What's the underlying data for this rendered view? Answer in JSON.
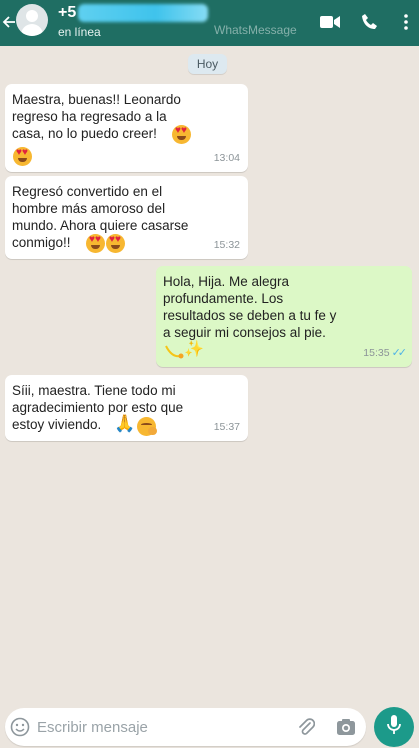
{
  "header": {
    "contact_name_prefix": "+5",
    "status": "en línea",
    "watermark": "WhatsMessage",
    "icons": [
      "back-arrow-icon",
      "avatar",
      "video-call-icon",
      "phone-call-icon"
    ]
  },
  "chat": {
    "date_label": "Hoy",
    "messages": [
      {
        "direction": "incoming",
        "text": "Maestra, buenas!! Leonardo\nregreso ha regresado a la\ncasa, no lo puedo creer!",
        "emoji": [
          "heart-eyes-emoji",
          "heart-eyes-emoji"
        ],
        "time": "13:04"
      },
      {
        "direction": "incoming",
        "text": "Regresó convertido en el\nhombre más amoroso del\nmundo. Ahora quiere casarse\nconmigo!!",
        "emoji": [
          "heart-eyes-emoji",
          "heart-eyes-emoji"
        ],
        "time": "15:32"
      },
      {
        "direction": "outgoing",
        "text": "Hola, Hija. Me alegra\nprofundamente. Los\nresultados se deben a tu fe y\na seguir mi consejos al pie.",
        "emoji": [
          "comet-emoji",
          "sparkles-emoji"
        ],
        "time": "15:35",
        "read": true
      },
      {
        "direction": "incoming",
        "text": "Síii, maestra. Tiene todo mi\nagradecimiento por esto que\nestoy viviendo.",
        "emoji": [
          "folded-hands-emoji",
          "hugging-face-emoji"
        ],
        "time": "15:37"
      }
    ]
  },
  "composer": {
    "placeholder": "Escribir mensaje",
    "icons": [
      "emoji-icon",
      "attach-icon",
      "camera-icon",
      "microphone-icon"
    ]
  },
  "colors": {
    "header": "#1f6e63",
    "background": "#ebe5de",
    "incoming": "#ffffff",
    "outgoing": "#dcf8c6",
    "mic_button": "#1c9a8a",
    "read_ticks": "#4fb3e6"
  }
}
